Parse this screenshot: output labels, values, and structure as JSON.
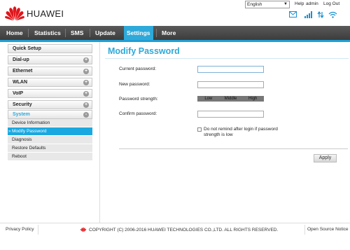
{
  "header": {
    "brand": "HUAWEI",
    "language": "English",
    "help": "Help",
    "user": "admin",
    "logout": "Log Out"
  },
  "nav": {
    "items": [
      "Home",
      "Statistics",
      "SMS",
      "Update",
      "Settings",
      "More"
    ],
    "active": "Settings"
  },
  "sidebar": {
    "groups": [
      {
        "label": "Quick Setup"
      },
      {
        "label": "Dial-up",
        "toggle": "+"
      },
      {
        "label": "Ethernet",
        "toggle": "+"
      },
      {
        "label": "WLAN",
        "toggle": "+"
      },
      {
        "label": "VoIP",
        "toggle": "+"
      },
      {
        "label": "Security",
        "toggle": "+"
      },
      {
        "label": "System",
        "toggle": "-"
      }
    ],
    "system_items": [
      "Device Information",
      "Modify Password",
      "Diagnosis",
      "Restore Defaults",
      "Reboot"
    ],
    "active_item": "Modify Password",
    "active_bullet": "»"
  },
  "main": {
    "title": "Modify Password",
    "fields": {
      "current_password": {
        "label": "Current password:",
        "value": ""
      },
      "new_password": {
        "label": "New password:",
        "value": ""
      },
      "confirm_password": {
        "label": "Confirm password:",
        "value": ""
      }
    },
    "strength": {
      "label": "Password strength:",
      "levels": [
        "Low",
        "Middle",
        "High"
      ]
    },
    "remind_checkbox": {
      "label": "Do not remind after login if password strength is low",
      "checked": false
    },
    "apply": "Apply"
  },
  "footer": {
    "privacy": "Privacy Policy",
    "copyright": "COPYRIGHT (C) 2006-2016 HUAWEI TECHNOLOGIES CO.,LTD. ALL RIGHTS RESERVED.",
    "open_source": "Open Source Notice"
  },
  "colors": {
    "accent": "#2ea9d9",
    "brand_red": "#e0161c",
    "nav_bg": "#4a4a4a",
    "sidebar_active": "#1aa8e0"
  }
}
